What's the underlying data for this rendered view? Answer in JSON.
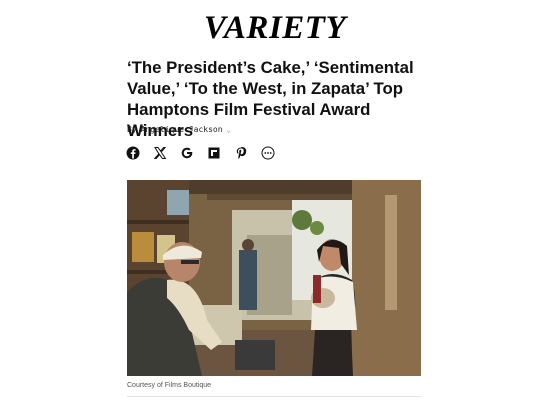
{
  "brand": {
    "logo_text": "VARIETY"
  },
  "article": {
    "headline": "‘The President’s Cake,’ ‘Sentimental Value,’ ‘To the West, in Zapata’ Top Hamptons Film Festival Award Winners",
    "byline_prefix": "By",
    "author": "Angelique Jackson",
    "author_chevron": "⌄",
    "caption": "Courtesy of Films Boutique"
  },
  "share": {
    "items": [
      "facebook-icon",
      "x-icon",
      "google-icon",
      "flipboard-icon",
      "pinterest-icon",
      "more-icon"
    ]
  },
  "colors": {
    "text": "#111111",
    "logo": "#000000",
    "caption": "#555555"
  }
}
